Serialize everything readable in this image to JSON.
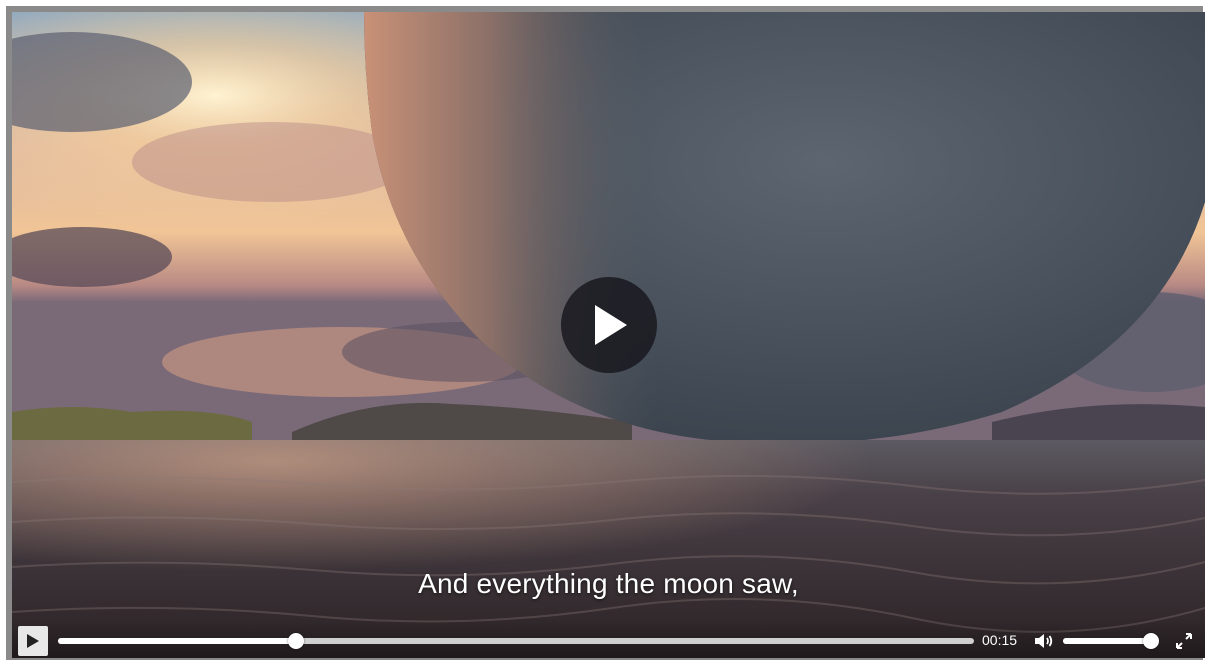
{
  "video": {
    "subtitle": "And everything the moon saw,",
    "current_time": "00:15",
    "progress_fraction": 0.26,
    "volume_fraction": 0.96
  },
  "icons": {
    "big_play": "play-icon",
    "control_play": "play-icon",
    "volume": "volume-icon",
    "fullscreen": "fullscreen-icon"
  },
  "colors": {
    "control_bg": "#e8e8e8",
    "track": "#cfcfcf",
    "fill": "#ffffff",
    "big_play_bg": "#19191e"
  }
}
